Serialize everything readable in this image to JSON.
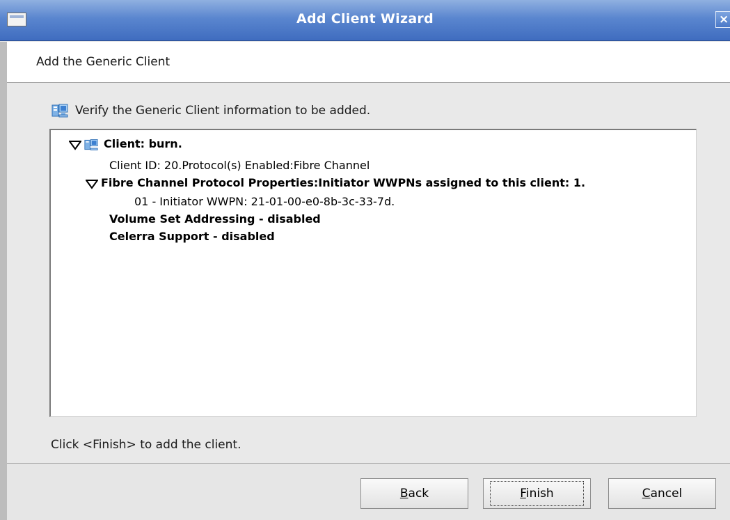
{
  "window": {
    "title": "Add Client Wizard",
    "close_glyph": "×"
  },
  "header": {
    "title": "Add the Generic Client"
  },
  "content": {
    "instruction": "Verify the Generic Client information to be added.",
    "tree": {
      "client_label": "Client: burn.",
      "client_details": "Client ID: 20.Protocol(s) Enabled:Fibre Channel",
      "protocol_label": "Fibre Channel Protocol Properties:Initiator WWPNs assigned to this client: 1.",
      "wwpn": "01 - Initiator WWPN: 21-01-00-e0-8b-3c-33-7d.",
      "volume_set": "Volume Set Addressing - disabled",
      "celerra": "Celerra Support - disabled"
    },
    "hint": "Click <Finish> to add the client."
  },
  "buttons": {
    "back": {
      "mnemonic": "B",
      "rest": "ack"
    },
    "finish": {
      "mnemonic": "F",
      "rest": "inish"
    },
    "cancel": {
      "mnemonic": "C",
      "rest": "ancel"
    }
  },
  "icons": {
    "window_menu": "window-menu-icon",
    "close": "close-icon",
    "client": "client-icon",
    "expand": "expanded-triangle-icon"
  },
  "colors": {
    "titlebar": "#5a86cf",
    "title_text": "#ffffff",
    "tree_background": "#ffffff",
    "dialog_background": "#e9e9e9"
  }
}
